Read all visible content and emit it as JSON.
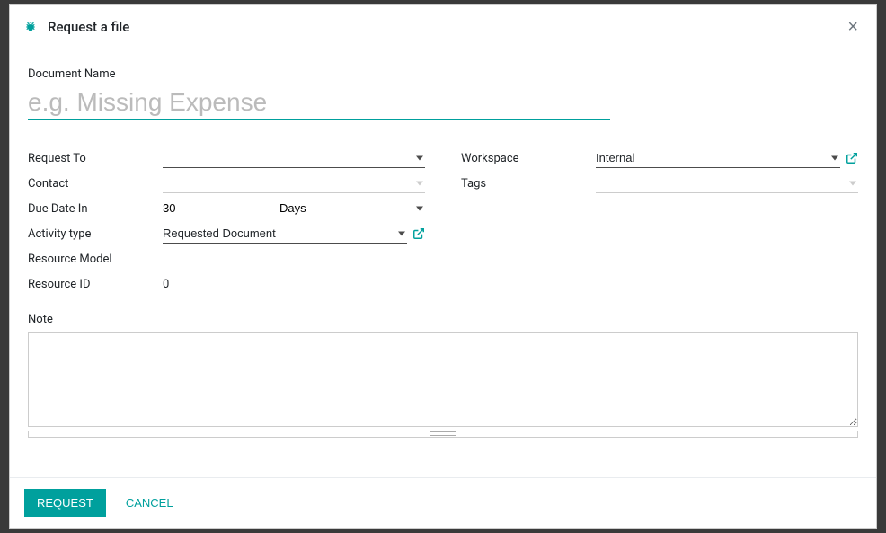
{
  "modal": {
    "title": "Request a file"
  },
  "form": {
    "document_name": {
      "label": "Document Name",
      "placeholder": "e.g. Missing Expense",
      "value": ""
    },
    "request_to": {
      "label": "Request To",
      "value": ""
    },
    "contact": {
      "label": "Contact",
      "value": ""
    },
    "due_date": {
      "label": "Due Date In",
      "value": "30",
      "unit": "Days"
    },
    "activity_type": {
      "label": "Activity type",
      "value": "Requested Document"
    },
    "resource_model": {
      "label": "Resource Model",
      "value": ""
    },
    "resource_id": {
      "label": "Resource ID",
      "value": "0"
    },
    "workspace": {
      "label": "Workspace",
      "value": "Internal"
    },
    "tags": {
      "label": "Tags",
      "value": ""
    },
    "note": {
      "label": "Note",
      "value": ""
    }
  },
  "footer": {
    "request": "Request",
    "cancel": "Cancel"
  }
}
